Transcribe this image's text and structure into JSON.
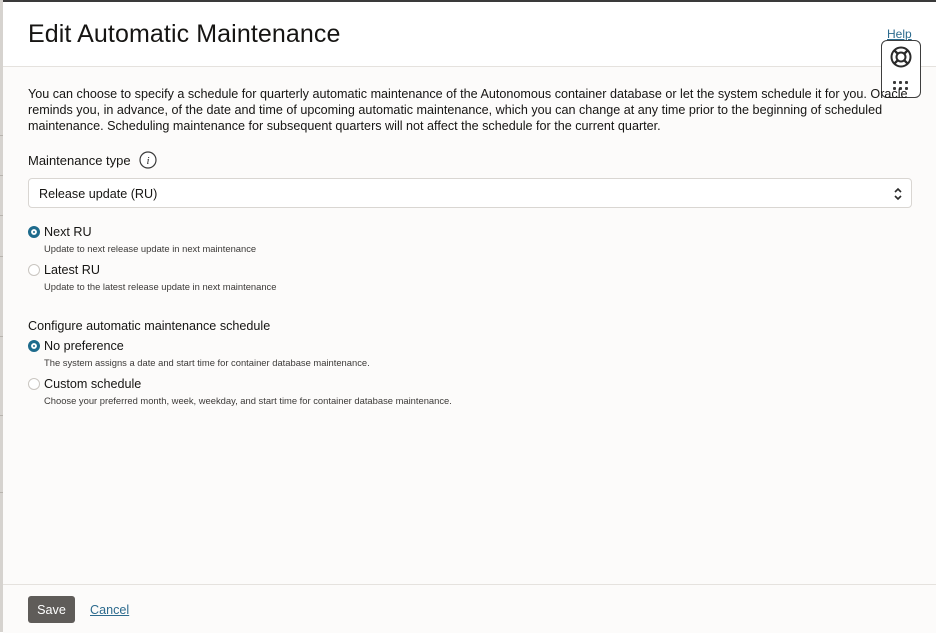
{
  "dialog": {
    "title": "Edit Automatic Maintenance",
    "help_label": "Help",
    "intro": "You can choose to specify a schedule for quarterly automatic maintenance of the Autonomous container database or let the system schedule it for you. Oracle reminds you, in advance, of the date and time of upcoming automatic maintenance, which you can change at any time prior to the beginning of scheduled maintenance. Scheduling maintenance for subsequent quarters will not affect the schedule for the current quarter."
  },
  "maintenance_type": {
    "label": "Maintenance type",
    "selected": "Release update (RU)",
    "info_icon": "info-icon"
  },
  "update_options": [
    {
      "label": "Next RU",
      "help": "Update to next release update in next maintenance",
      "checked": true
    },
    {
      "label": "Latest RU",
      "help": "Update to the latest release update in next maintenance",
      "checked": false
    }
  ],
  "schedule": {
    "title": "Configure automatic maintenance schedule",
    "options": [
      {
        "label": "No preference",
        "help": "The system assigns a date and start time for container database maintenance.",
        "checked": true
      },
      {
        "label": "Custom schedule",
        "help": "Choose your preferred month, week, weekday, and start time for container database maintenance.",
        "checked": false
      }
    ]
  },
  "footer": {
    "save_label": "Save",
    "cancel_label": "Cancel"
  },
  "colors": {
    "accent": "#1e6b8c",
    "link": "#2d6b8e",
    "save_button_bg": "#5f5c59"
  },
  "icons": {
    "help_widget": "lifebuoy-icon",
    "help_menu": "grid-dots-icon",
    "select_toggle": "updown-chevron-icon"
  }
}
